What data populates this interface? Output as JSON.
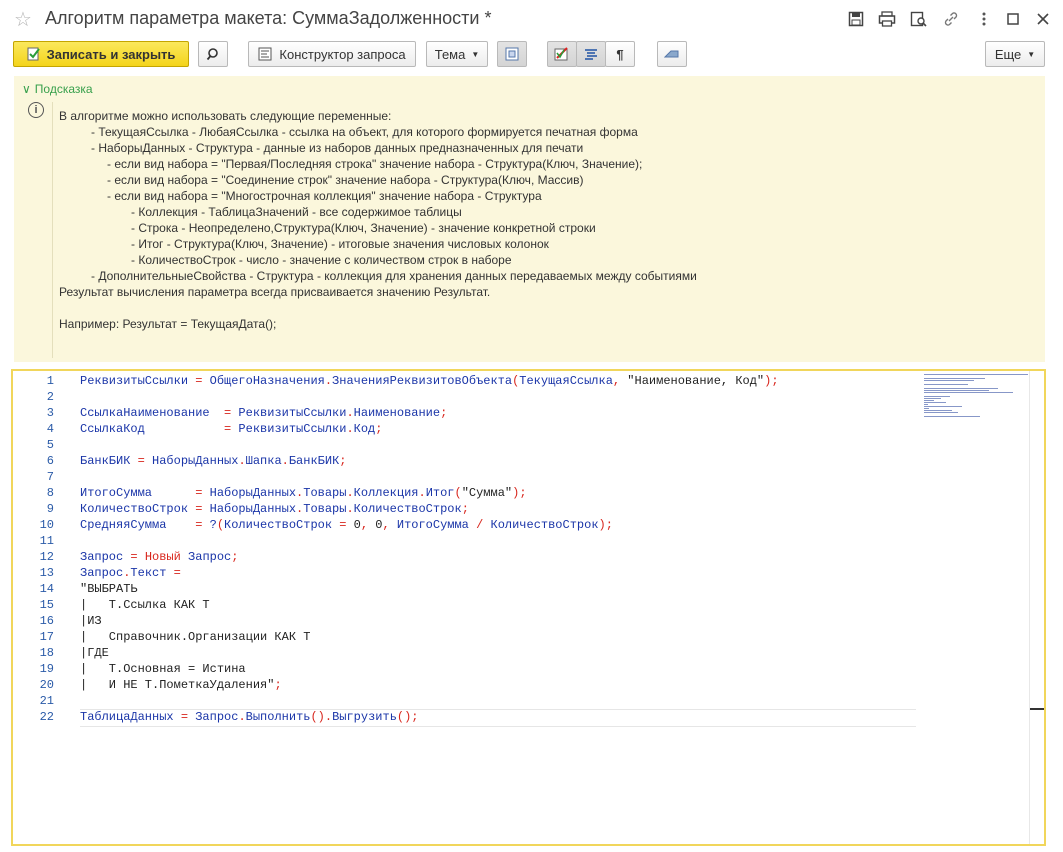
{
  "window": {
    "title": "Алгоритм параметра макета: СуммаЗадолженности *"
  },
  "toolbar": {
    "save_close": "Записать и закрыть",
    "query_builder": "Конструктор запроса",
    "theme": "Тема",
    "more": "Еще"
  },
  "hint": {
    "header": "Подсказка",
    "lines": [
      {
        "text": "В алгоритме можно использовать следующие переменные:",
        "indent": 0
      },
      {
        "text": "- ТекущаяСсылка - ЛюбаяСсылка - ссылка на объект, для которого формируется печатная форма",
        "indent": 1
      },
      {
        "text": "- НаборыДанных - Структура - данные из наборов данных предназначенных для печати",
        "indent": 1
      },
      {
        "text": "- если вид набора = \"Первая/Последняя строка\" значение набора - Структура(Ключ, Значение);",
        "indent": 2
      },
      {
        "text": "- если вид набора = \"Соединение строк\" значение набора - Структура(Ключ, Массив)",
        "indent": 2
      },
      {
        "text": "- если вид набора = \"Многострочная коллекция\" значение набора - Структура",
        "indent": 2
      },
      {
        "text": "- Коллекция - ТаблицаЗначений - все содержимое таблицы",
        "indent": 3
      },
      {
        "text": "- Строка - Неопределено,Структура(Ключ, Значение) - значение конкретной строки",
        "indent": 3
      },
      {
        "text": "- Итог - Структура(Ключ, Значение) - итоговые значения числовых колонок",
        "indent": 3
      },
      {
        "text": "- КоличествоСтрок - число - значение с количеством строк в наборе",
        "indent": 3
      },
      {
        "text": "- ДополнительныеСвойства - Структура - коллекция для хранения данных передаваемых между событиями",
        "indent": 1
      },
      {
        "text": "Результат вычисления параметра всегда присваивается значению Результат.",
        "indent": 0
      },
      {
        "text": "",
        "indent": 0
      },
      {
        "text": "Например: Результат = ТекущаяДата();",
        "indent": 0
      }
    ]
  },
  "editor": {
    "lines": [
      {
        "n": "1",
        "tokens": [
          [
            "id",
            "РеквизитыСсылки "
          ],
          [
            "op",
            "="
          ],
          [
            "id",
            " ОбщегоНазначения"
          ],
          [
            "op",
            "."
          ],
          [
            "id",
            "ЗначенияРеквизитовОбъекта"
          ],
          [
            "op",
            "("
          ],
          [
            "id",
            "ТекущаяСсылка"
          ],
          [
            "op",
            ","
          ],
          [
            "str",
            " \"Наименование, Код\""
          ],
          [
            "op",
            ");"
          ]
        ]
      },
      {
        "n": "2",
        "tokens": []
      },
      {
        "n": "3",
        "tokens": [
          [
            "id",
            "СсылкаНаименование  "
          ],
          [
            "op",
            "="
          ],
          [
            "id",
            " РеквизитыСсылки"
          ],
          [
            "op",
            "."
          ],
          [
            "id",
            "Наименование"
          ],
          [
            "op",
            ";"
          ]
        ]
      },
      {
        "n": "4",
        "tokens": [
          [
            "id",
            "СсылкаКод           "
          ],
          [
            "op",
            "="
          ],
          [
            "id",
            " РеквизитыСсылки"
          ],
          [
            "op",
            "."
          ],
          [
            "id",
            "Код"
          ],
          [
            "op",
            ";"
          ]
        ]
      },
      {
        "n": "5",
        "tokens": []
      },
      {
        "n": "6",
        "tokens": [
          [
            "id",
            "БанкБИК "
          ],
          [
            "op",
            "="
          ],
          [
            "id",
            " НаборыДанных"
          ],
          [
            "op",
            "."
          ],
          [
            "id",
            "Шапка"
          ],
          [
            "op",
            "."
          ],
          [
            "id",
            "БанкБИК"
          ],
          [
            "op",
            ";"
          ]
        ]
      },
      {
        "n": "7",
        "tokens": []
      },
      {
        "n": "8",
        "tokens": [
          [
            "id",
            "ИтогоСумма      "
          ],
          [
            "op",
            "="
          ],
          [
            "id",
            " НаборыДанных"
          ],
          [
            "op",
            "."
          ],
          [
            "id",
            "Товары"
          ],
          [
            "op",
            "."
          ],
          [
            "id",
            "Коллекция"
          ],
          [
            "op",
            "."
          ],
          [
            "id",
            "Итог"
          ],
          [
            "op",
            "("
          ],
          [
            "str",
            "\"Сумма\""
          ],
          [
            "op",
            ");"
          ]
        ]
      },
      {
        "n": "9",
        "tokens": [
          [
            "id",
            "КоличествоСтрок "
          ],
          [
            "op",
            "="
          ],
          [
            "id",
            " НаборыДанных"
          ],
          [
            "op",
            "."
          ],
          [
            "id",
            "Товары"
          ],
          [
            "op",
            "."
          ],
          [
            "id",
            "КоличествоСтрок"
          ],
          [
            "op",
            ";"
          ]
        ]
      },
      {
        "n": "10",
        "tokens": [
          [
            "id",
            "СредняяСумма    "
          ],
          [
            "op",
            "="
          ],
          [
            "id",
            " ?"
          ],
          [
            "op",
            "("
          ],
          [
            "id",
            "КоличествоСтрок "
          ],
          [
            "op",
            "="
          ],
          [
            "num",
            " 0"
          ],
          [
            "op",
            ","
          ],
          [
            "num",
            " 0"
          ],
          [
            "op",
            ","
          ],
          [
            "id",
            " ИтогоСумма "
          ],
          [
            "op",
            "/"
          ],
          [
            "id",
            " КоличествоСтрок"
          ],
          [
            "op",
            ");"
          ]
        ]
      },
      {
        "n": "11",
        "tokens": []
      },
      {
        "n": "12",
        "tokens": [
          [
            "id",
            "Запрос "
          ],
          [
            "op",
            "="
          ],
          [
            "kw",
            " Новый"
          ],
          [
            "id",
            " Запрос"
          ],
          [
            "op",
            ";"
          ]
        ]
      },
      {
        "n": "13",
        "tokens": [
          [
            "id",
            "Запрос"
          ],
          [
            "op",
            "."
          ],
          [
            "id",
            "Текст "
          ],
          [
            "op",
            "="
          ]
        ]
      },
      {
        "n": "14",
        "tokens": [
          [
            "str",
            "\"ВЫБРАТЬ"
          ]
        ]
      },
      {
        "n": "15",
        "tokens": [
          [
            "str",
            "|   Т.Ссылка КАК Т"
          ]
        ]
      },
      {
        "n": "16",
        "tokens": [
          [
            "str",
            "|ИЗ"
          ]
        ]
      },
      {
        "n": "17",
        "tokens": [
          [
            "str",
            "|   Справочник.Организации КАК Т"
          ]
        ]
      },
      {
        "n": "18",
        "tokens": [
          [
            "str",
            "|ГДЕ"
          ]
        ]
      },
      {
        "n": "19",
        "tokens": [
          [
            "str",
            "|   Т.Основная = Истина"
          ]
        ]
      },
      {
        "n": "20",
        "tokens": [
          [
            "str",
            "|   И НЕ Т.ПометкаУдаления\""
          ],
          [
            "op",
            ";"
          ]
        ]
      },
      {
        "n": "21",
        "tokens": []
      },
      {
        "n": "22",
        "tokens": [
          [
            "id",
            "ТаблицаДанных "
          ],
          [
            "op",
            "="
          ],
          [
            "id",
            " Запрос"
          ],
          [
            "op",
            "."
          ],
          [
            "id",
            "Выполнить"
          ],
          [
            "op",
            "()."
          ],
          [
            "id",
            "Выгрузить"
          ],
          [
            "op",
            "();"
          ]
        ]
      }
    ]
  },
  "icons": {
    "favorite": "star-icon",
    "save": "save-icon",
    "print": "print-icon",
    "preview": "preview-icon",
    "link": "link-icon",
    "more": "more-icon",
    "maximize": "maximize-icon",
    "close": "close-icon",
    "search": "search-icon"
  }
}
